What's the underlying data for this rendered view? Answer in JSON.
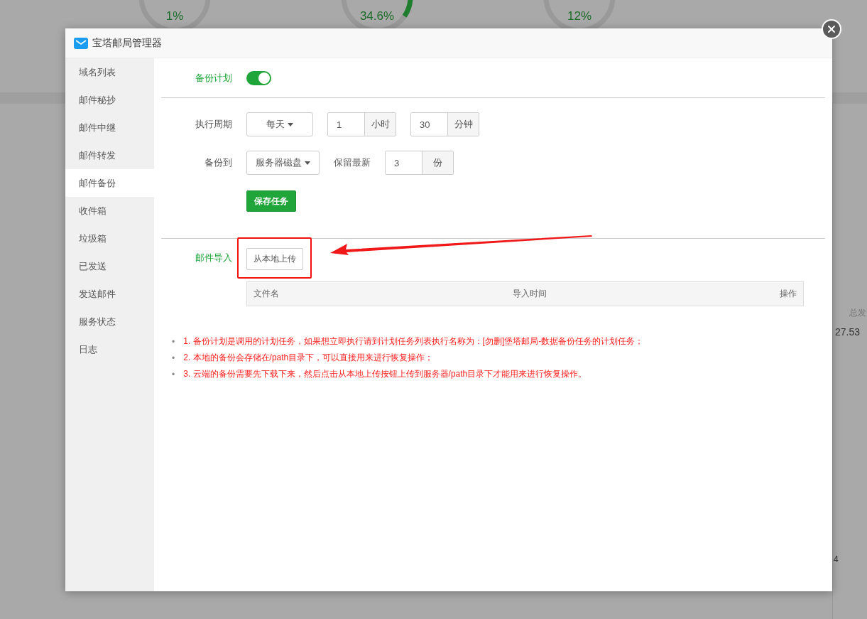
{
  "background": {
    "gauges": [
      {
        "value": "1%",
        "kind": "ring"
      },
      {
        "value": "34.6%",
        "kind": "arc"
      },
      {
        "value": "12%",
        "kind": "ring"
      }
    ],
    "stat_label": "总发",
    "stat_value": "27.53",
    "axis_label": "4"
  },
  "dialog": {
    "title": "宝塔邮局管理器",
    "sidebar": [
      {
        "label": "域名列表",
        "selected": false
      },
      {
        "label": "邮件秘抄",
        "selected": false
      },
      {
        "label": "邮件中继",
        "selected": false
      },
      {
        "label": "邮件转发",
        "selected": false
      },
      {
        "label": "邮件备份",
        "selected": true
      },
      {
        "label": "收件箱",
        "selected": false
      },
      {
        "label": "垃圾箱",
        "selected": false
      },
      {
        "label": "已发送",
        "selected": false
      },
      {
        "label": "发送邮件",
        "selected": false
      },
      {
        "label": "服务状态",
        "selected": false
      },
      {
        "label": "日志",
        "selected": false
      }
    ],
    "backup_plan": {
      "label": "备份计划",
      "on": true
    },
    "schedule": {
      "label": "执行周期",
      "period": "每天",
      "hours": "1",
      "hours_unit": "小时",
      "minutes": "30",
      "minutes_unit": "分钟"
    },
    "destination": {
      "label": "备份到",
      "target": "服务器磁盘",
      "keep_label": "保留最新",
      "keep": "3",
      "keep_unit": "份"
    },
    "save_button": "保存任务",
    "import": {
      "label": "邮件导入",
      "upload_button": "从本地上传",
      "highlighted": true
    },
    "table": {
      "columns": [
        "文件名",
        "导入时间",
        "操作"
      ]
    },
    "notes": [
      {
        "bullet": "•",
        "text": "1. 备份计划是调用的计划任务，如果想立即执行请到计划任务列表执行名称为：[勿删]堡塔邮局-数据备份任务的计划任务；"
      },
      {
        "bullet": "•",
        "text": "2. 本地的备份会存储在/path目录下，可以直接用来进行恢复操作；"
      },
      {
        "bullet": "•",
        "text": "3. 云端的备份需要先下载下来，然后点击从本地上传按钮上传到服务器/path目录下才能用来进行恢复操作。"
      }
    ]
  }
}
